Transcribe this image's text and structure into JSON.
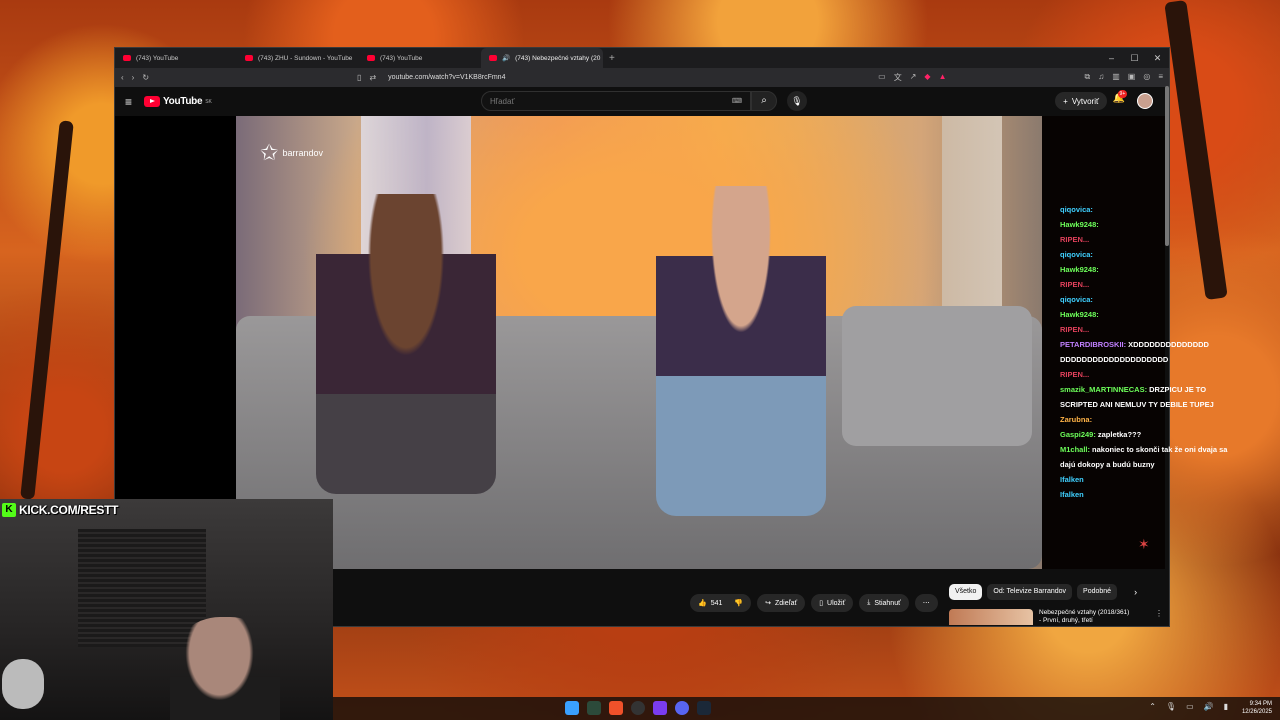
{
  "browser": {
    "tabs": [
      {
        "title": "(743) YouTube",
        "active": false
      },
      {
        "title": "(743) ZHU - Sundown - YouTube",
        "active": false
      },
      {
        "title": "(743) YouTube",
        "active": false
      },
      {
        "title": "(743) Nebezpečné vztahy (20",
        "active": true
      }
    ],
    "url": "youtube.com/watch?v=V1KB8rcFmn4"
  },
  "youtube": {
    "logo": "YouTube",
    "country": "SK",
    "search_placeholder": "Hľadať",
    "create_label": "Vytvoriť",
    "notif_count": "9+",
    "actions": {
      "likes": "541",
      "share": "Zdieľať",
      "save": "Uložiť",
      "download": "Stiahnuť"
    },
    "chips": [
      "Všetko",
      "Od: Televize Barrandov",
      "Podobné"
    ],
    "rec": {
      "title": "Nebezpečné vztahy (2018/361)",
      "subtitle": "- První, druhý, třetí"
    }
  },
  "video": {
    "channel_logo": "barrandov"
  },
  "chat": [
    {
      "user": "qiqovica:",
      "msg": "",
      "color": "#3fd0ff"
    },
    {
      "user": "Hawk9248:",
      "msg": "",
      "color": "#6dff5a"
    },
    {
      "user": "RIPEN...",
      "msg": "",
      "color": "#e0405a"
    },
    {
      "user": "qiqovica:",
      "msg": "",
      "color": "#3fd0ff"
    },
    {
      "user": "Hawk9248:",
      "msg": "",
      "color": "#6dff5a"
    },
    {
      "user": "RIPEN...",
      "msg": "",
      "color": "#e0405a"
    },
    {
      "user": "qiqovica:",
      "msg": "",
      "color": "#3fd0ff"
    },
    {
      "user": "Hawk9248:",
      "msg": "",
      "color": "#6dff5a"
    },
    {
      "user": "RIPEN...",
      "msg": "",
      "color": "#e0405a"
    },
    {
      "user": "PETARDIBROSKII:",
      "msg": "XDDDDDDDDDDDDDD DDDDDDDDDDDDDDDDDDDD",
      "color": "#c080ff"
    },
    {
      "user": "RIPEN...",
      "msg": "",
      "color": "#e0405a"
    },
    {
      "user": "smazik_MARTINNECAS:",
      "msg": "DRZPICU JE TO SCRIPTED ANI NEMLUV TY DEBILE TUPEJ",
      "color": "#6dff5a"
    },
    {
      "user": "Zarubna:",
      "msg": "",
      "color": "#ffb347"
    },
    {
      "user": "Gaspi249:",
      "msg": "zapletka???",
      "color": "#6dff5a"
    },
    {
      "user": "M1chall:",
      "msg": "nakoniec to skonči tak že oni dvaja sa dajú dokopy a budú buzny",
      "color": "#6dff5a"
    },
    {
      "user": "Ifalken",
      "msg": "",
      "color": "#3fd0ff"
    },
    {
      "user": "Ifalken",
      "msg": "",
      "color": "#3fd0ff"
    }
  ],
  "stream": {
    "kick_label": "KICK.COM/RESTT"
  },
  "taskbar": {
    "time": "9:34 PM",
    "date": "12/26/2025"
  }
}
